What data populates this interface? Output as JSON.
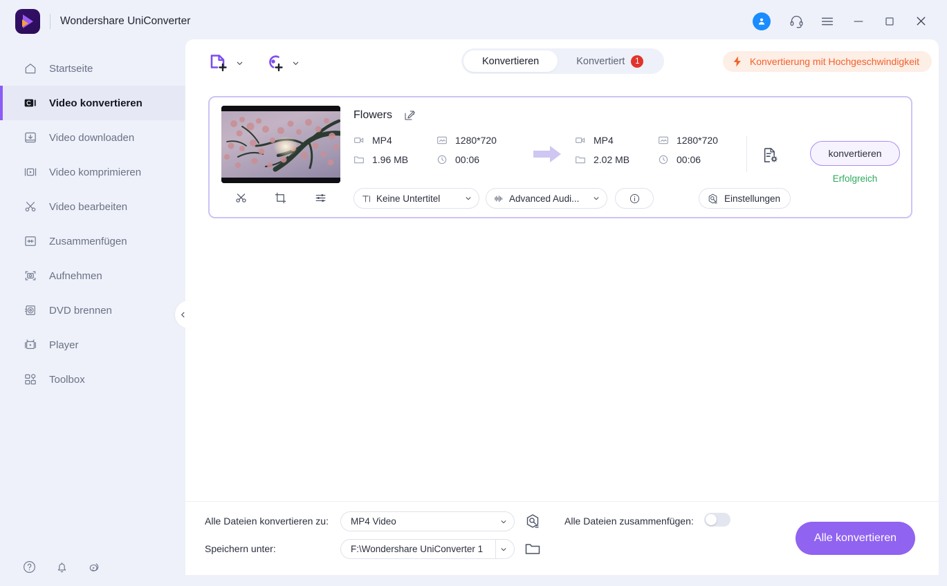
{
  "window": {
    "title": "Wondershare UniConverter",
    "controls": {
      "account": "account-icon",
      "support": "headset-icon",
      "menu": "hamburger-icon",
      "minimize": "minimize-icon",
      "maximize": "maximize-icon",
      "close": "close-icon"
    }
  },
  "sidebar": {
    "items": [
      {
        "label": "Startseite",
        "icon": "home-icon",
        "active": false
      },
      {
        "label": "Video konvertieren",
        "icon": "convert-icon",
        "active": true
      },
      {
        "label": "Video downloaden",
        "icon": "download-icon",
        "active": false
      },
      {
        "label": "Video komprimieren",
        "icon": "compress-icon",
        "active": false
      },
      {
        "label": "Video bearbeiten",
        "icon": "scissors-icon",
        "active": false
      },
      {
        "label": "Zusammenfügen",
        "icon": "merge-icon",
        "active": false
      },
      {
        "label": "Aufnehmen",
        "icon": "record-icon",
        "active": false
      },
      {
        "label": "DVD brennen",
        "icon": "disc-icon",
        "active": false
      },
      {
        "label": "Player",
        "icon": "player-icon",
        "active": false
      },
      {
        "label": "Toolbox",
        "icon": "toolbox-icon",
        "active": false
      }
    ],
    "bottom_icons": [
      "help-icon",
      "bell-icon",
      "feedback-icon"
    ],
    "collapse": "chevron-left-icon"
  },
  "toolbar": {
    "add_file_icon": "add-file-icon",
    "add_disc_icon": "add-disc-icon",
    "tabs": [
      {
        "label": "Konvertieren",
        "active": true,
        "badge": null
      },
      {
        "label": "Konvertiert",
        "active": false,
        "badge": "1"
      }
    ],
    "high_speed_label": "Konvertierung mit Hochgeschwindigkeit",
    "high_speed_icon": "lightning-bolt-icon"
  },
  "file_card": {
    "title": "Flowers",
    "rename_icon": "edit-pencil-icon",
    "thumb_tools": [
      "trim-scissors-icon",
      "crop-icon",
      "effects-sliders-icon"
    ],
    "source": {
      "format": "MP4",
      "resolution": "1280*720",
      "size": "1.96 MB",
      "duration": "00:06"
    },
    "output": {
      "format": "MP4",
      "resolution": "1280*720",
      "size": "2.02 MB",
      "duration": "00:06"
    },
    "arrow_icon": "arrow-right-icon",
    "file_settings_icon": "file-gear-icon",
    "convert_button": "konvertieren",
    "status": "Erfolgreich",
    "subtitle_select": {
      "value": "Keine Untertitel",
      "icon": "subtitle-text-icon"
    },
    "audio_select": {
      "value": "Advanced Audi...",
      "icon": "audio-wave-icon"
    },
    "info_button_icon": "info-circle-icon",
    "settings_button": {
      "label": "Einstellungen",
      "icon": "settings-gear-icon"
    }
  },
  "bottom_bar": {
    "convert_all_to_label": "Alle Dateien konvertieren zu:",
    "format_value": "MP4 Video",
    "format_gear_icon": "format-settings-icon",
    "save_to_label": "Speichern unter:",
    "path_value": "F:\\Wondershare UniConverter 1",
    "folder_icon": "folder-icon",
    "merge_label": "Alle Dateien zusammenfügen:",
    "merge_enabled": false,
    "convert_all_button": "Alle konvertieren"
  },
  "colors": {
    "accent_purple": "#8b5cf6",
    "convert_all_bg": "#9063f0",
    "badge_red": "#e0342c",
    "success_green": "#2cab5c",
    "high_speed_orange": "#f2622a",
    "app_bg": "#eef1f9"
  }
}
